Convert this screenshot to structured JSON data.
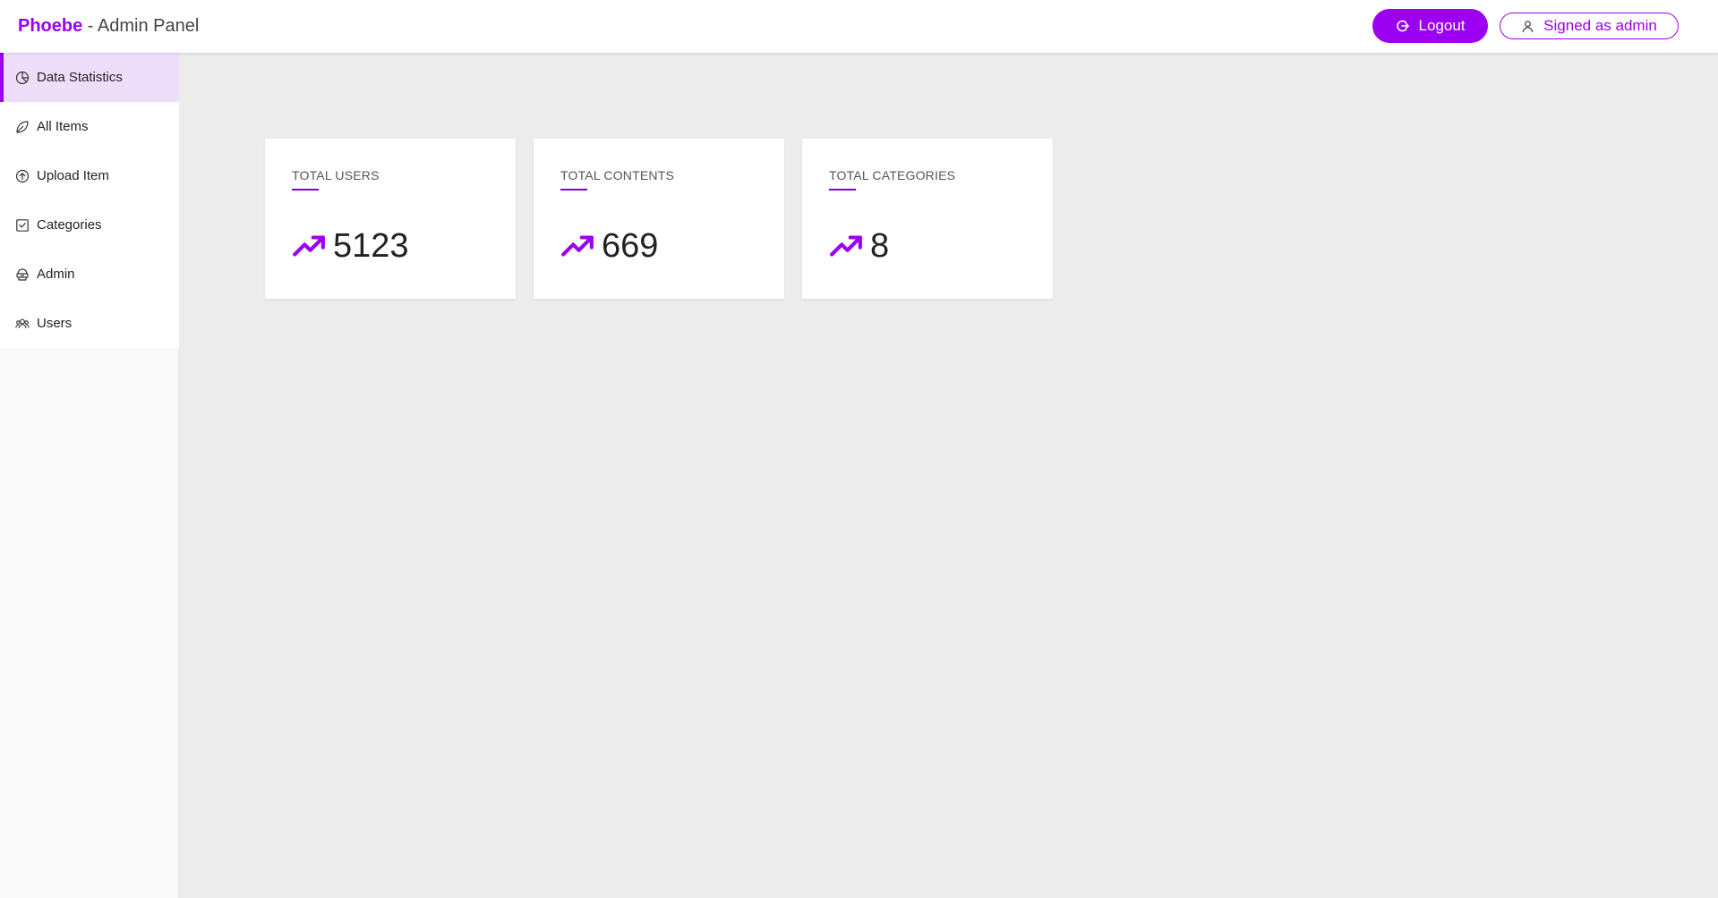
{
  "header": {
    "brand_name": "Phoebe",
    "brand_separator": " - ",
    "brand_subtitle": "Admin Panel",
    "logout_label": "Logout",
    "signed_label": "Signed as admin"
  },
  "sidebar": {
    "items": [
      {
        "label": "Data Statistics",
        "icon": "pie-chart-icon",
        "active": true
      },
      {
        "label": "All Items",
        "icon": "leaf-icon",
        "active": false
      },
      {
        "label": "Upload Item",
        "icon": "upload-circle-icon",
        "active": false
      },
      {
        "label": "Categories",
        "icon": "checkbox-icon",
        "active": false
      },
      {
        "label": "Admin",
        "icon": "admin-icon",
        "active": false
      },
      {
        "label": "Users",
        "icon": "users-icon",
        "active": false
      }
    ]
  },
  "stats": {
    "cards": [
      {
        "title": "TOTAL USERS",
        "value": "5123",
        "icon": "trending-up-icon"
      },
      {
        "title": "TOTAL CONTENTS",
        "value": "669",
        "icon": "trending-up-icon"
      },
      {
        "title": "TOTAL CATEGORIES",
        "value": "8",
        "icon": "trending-up-icon"
      }
    ]
  },
  "colors": {
    "accent": "#9b00f0",
    "active_bg": "#efdefa",
    "page_bg": "#ececec"
  }
}
